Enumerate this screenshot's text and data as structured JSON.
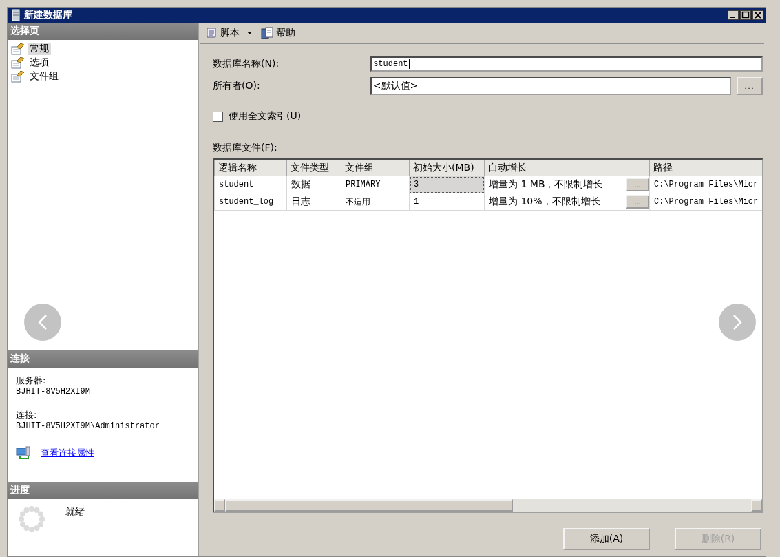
{
  "window": {
    "title": "新建数据库"
  },
  "sidebar": {
    "select_page": {
      "header": "选择页",
      "items": [
        {
          "label": "常规",
          "selected": true
        },
        {
          "label": "选项",
          "selected": false
        },
        {
          "label": "文件组",
          "selected": false
        }
      ]
    },
    "connection": {
      "header": "连接",
      "server_label": "服务器:",
      "server": "BJHIT-8V5H2XI9M",
      "connection_label": "连接:",
      "connection": "BJHIT-8V5H2XI9M\\Administrator",
      "link": "查看连接属性"
    },
    "progress": {
      "header": "进度",
      "status": "就绪"
    }
  },
  "toolbar": [
    {
      "label": "脚本",
      "kind": "script"
    },
    {
      "label": "帮助",
      "kind": "help"
    }
  ],
  "form": {
    "name_label": "数据库名称(N):",
    "name_value": "student",
    "owner_label": "所有者(O):",
    "owner_value": "<默认值>",
    "owner_browse": "...",
    "fulltext": {
      "label": "使用全文索引(U)",
      "checked": false
    },
    "files_label": "数据库文件(F):"
  },
  "table": {
    "columns": [
      "逻辑名称",
      "文件类型",
      "文件组",
      "初始大小(MB)",
      "自动增长",
      "路径"
    ],
    "rows": [
      {
        "cells": [
          "student",
          "数据",
          "PRIMARY",
          "3",
          "增量为 1 MB，不限制增长",
          "C:\\Program Files\\Micr"
        ],
        "browse": "...",
        "selected": true
      },
      {
        "cells": [
          "student_log",
          "日志",
          "不适用",
          "1",
          "增量为 10%，不限制增长",
          "C:\\Program Files\\Micr"
        ],
        "browse": "...",
        "selected": false
      }
    ]
  },
  "buttons": [
    {
      "label": "添加(A)",
      "disabled": false
    },
    {
      "label": "删除(R)",
      "disabled": true
    }
  ]
}
